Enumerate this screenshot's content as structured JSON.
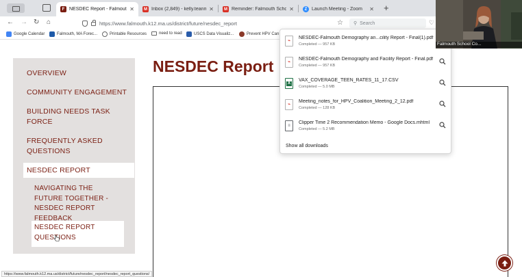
{
  "browser": {
    "tabs": [
      {
        "title": "NESDEC Report - Falmouth Pub",
        "favicon": "F",
        "favicon_color": "#7a1e12",
        "active": true
      },
      {
        "title": "Inbox (2,849) - kelly.teanmsurr",
        "favicon": "M",
        "favicon_color": "#d93025",
        "active": false
      },
      {
        "title": "Reminder: Falmouth School Com",
        "favicon": "M",
        "favicon_color": "#d93025",
        "active": false
      },
      {
        "title": "Launch Meeting - Zoom",
        "favicon": "Z",
        "favicon_color": "#2d8cff",
        "active": false
      }
    ],
    "url": "https://www.falmouth.k12.ma.us/district/future/nesdec_report",
    "search_placeholder": "Search"
  },
  "bookmarks": [
    {
      "label": "Google Calendar",
      "icon": "calendar-icon",
      "color": "#4285f4"
    },
    {
      "label": "Falmouth, MA Forec...",
      "icon": "weather-icon",
      "color": "#1e5aa8"
    },
    {
      "label": "Printable Resources",
      "icon": "resources-icon",
      "color": "#666666"
    },
    {
      "label": "need to read",
      "icon": "folder-icon",
      "color": "#666666"
    },
    {
      "label": "USCS Data Visualiz...",
      "icon": "data-icon",
      "color": "#2a5caa"
    },
    {
      "label": "Prevent HPV Can",
      "icon": "hpv-icon",
      "color": "#8b3a2a"
    }
  ],
  "sidebar": {
    "items": [
      {
        "label": "OVERVIEW"
      },
      {
        "label": "COMMUNITY ENGAGEMENT"
      },
      {
        "label": "BUILDING NEEDS TASK FORCE"
      },
      {
        "label": "FREQUENTLY ASKED QUESTIONS"
      },
      {
        "label": "NESDEC REPORT"
      }
    ],
    "subitems": [
      {
        "label": "NAVIGATING THE FUTURE TOGETHER - NESDEC REPORT FEEDBACK"
      },
      {
        "label": "NESDEC REPORT QUESTIONS"
      }
    ]
  },
  "main": {
    "title": "NESDEC Report"
  },
  "downloads": {
    "items": [
      {
        "name": "NESDEC-Falmouth Demography an...cility Report - Final(1).pdf",
        "status": "Completed — 957 KB",
        "type": "pdf"
      },
      {
        "name": "NESDEC-Falmouth Demography and Facility Report - Final.pdf",
        "status": "Completed — 957 KB",
        "type": "pdf"
      },
      {
        "name": "VAX_COVERAGE_TEEN_RATES_11_17.CSV",
        "status": "Completed — 5.0 MB",
        "type": "csv"
      },
      {
        "name": "Meeting_notes_for_HPV_Coalition_Meeting_2_12.pdf",
        "status": "Completed — 128 KB",
        "type": "pdf"
      },
      {
        "name": "Clipper Time 2 Recommendation Memo - Google Docs.mhtml",
        "status": "Completed — 5.2 MB",
        "type": "mhtml"
      }
    ],
    "show_all": "Show all downloads"
  },
  "status_url": "https://www.falmouth.k12.ma.us/district/future/nesdec_report/nesdec_report_questions/",
  "video": {
    "label": "Falmouth School Co..."
  },
  "colors": {
    "brand": "#7a1e12",
    "sidebar_bg": "#e3e0df",
    "pdf": "#d93025",
    "csv": "#1e7145"
  }
}
